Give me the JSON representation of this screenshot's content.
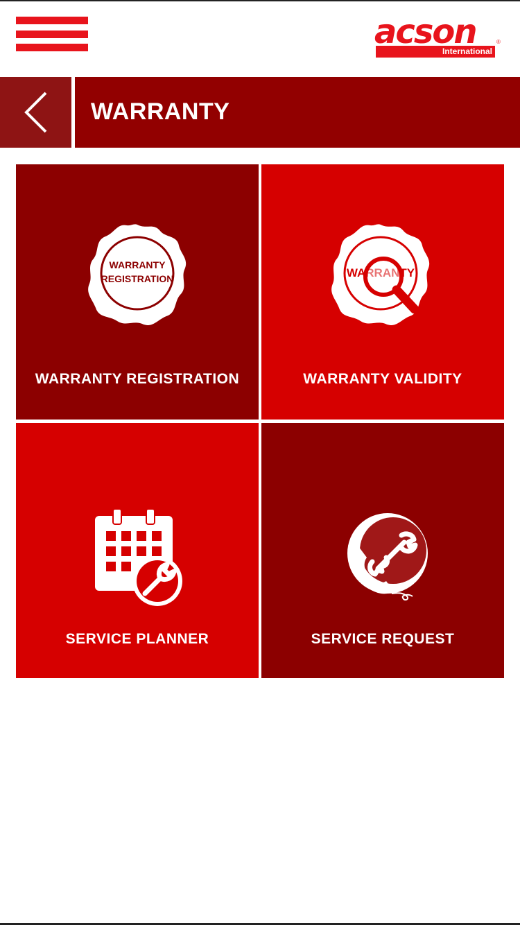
{
  "header": {
    "logo_word": "acson",
    "logo_sub": "International",
    "logo_reg": "®"
  },
  "title_bar": {
    "title": "WARRANTY"
  },
  "tiles": [
    {
      "label": "WARRANTY REGISTRATION",
      "icon": "warranty-registration-seal-icon",
      "badge_line1": "WARRANTY",
      "badge_line2": "REGISTRATION"
    },
    {
      "label": "WARRANTY VALIDITY",
      "icon": "warranty-magnifier-seal-icon",
      "badge_text": "WARRANTY"
    },
    {
      "label": "SERVICE PLANNER",
      "icon": "calendar-wrench-icon"
    },
    {
      "label": "SERVICE REQUEST",
      "icon": "phone-wrench-icon"
    }
  ],
  "colors": {
    "brand_red": "#e8141c",
    "dark_red": "#8c0000",
    "bright_red": "#d60000",
    "title_bar": "#920000",
    "back_button": "#8e1414"
  }
}
